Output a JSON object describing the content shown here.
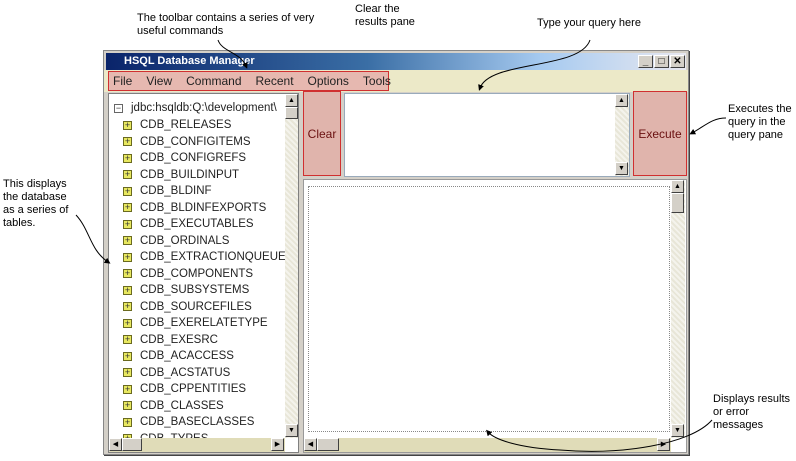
{
  "window": {
    "title": "HSQL Database Manager",
    "minimize": "_",
    "maximize": "□",
    "close": "✕"
  },
  "menu": [
    "File",
    "View",
    "Command",
    "Recent",
    "Options",
    "Tools"
  ],
  "tree": {
    "root": "jdbc:hsqldb:Q:\\development\\",
    "tables": [
      "CDB_RELEASES",
      "CDB_CONFIGITEMS",
      "CDB_CONFIGREFS",
      "CDB_BUILDINPUT",
      "CDB_BLDINF",
      "CDB_BLDINFEXPORTS",
      "CDB_EXECUTABLES",
      "CDB_ORDINALS",
      "CDB_EXTRACTIONQUEUE",
      "CDB_COMPONENTS",
      "CDB_SUBSYSTEMS",
      "CDB_SOURCEFILES",
      "CDB_EXERELATETYPE",
      "CDB_EXESRC",
      "CDB_ACACCESS",
      "CDB_ACSTATUS",
      "CDB_CPPENTITIES",
      "CDB_CLASSES",
      "CDB_BASECLASSES",
      "CDB_TYPES"
    ]
  },
  "buttons": {
    "clear": "Clear",
    "execute": "Execute"
  },
  "query": {
    "value": ""
  },
  "annotations": {
    "toolbar": "The toolbar contains a series of very useful commands",
    "clear": "Clear the results pane",
    "query": "Type your query here",
    "execute": "Executes the query in the query pane",
    "tree": "This displays the database as a series of tables.",
    "results": "Displays results or error messages"
  }
}
